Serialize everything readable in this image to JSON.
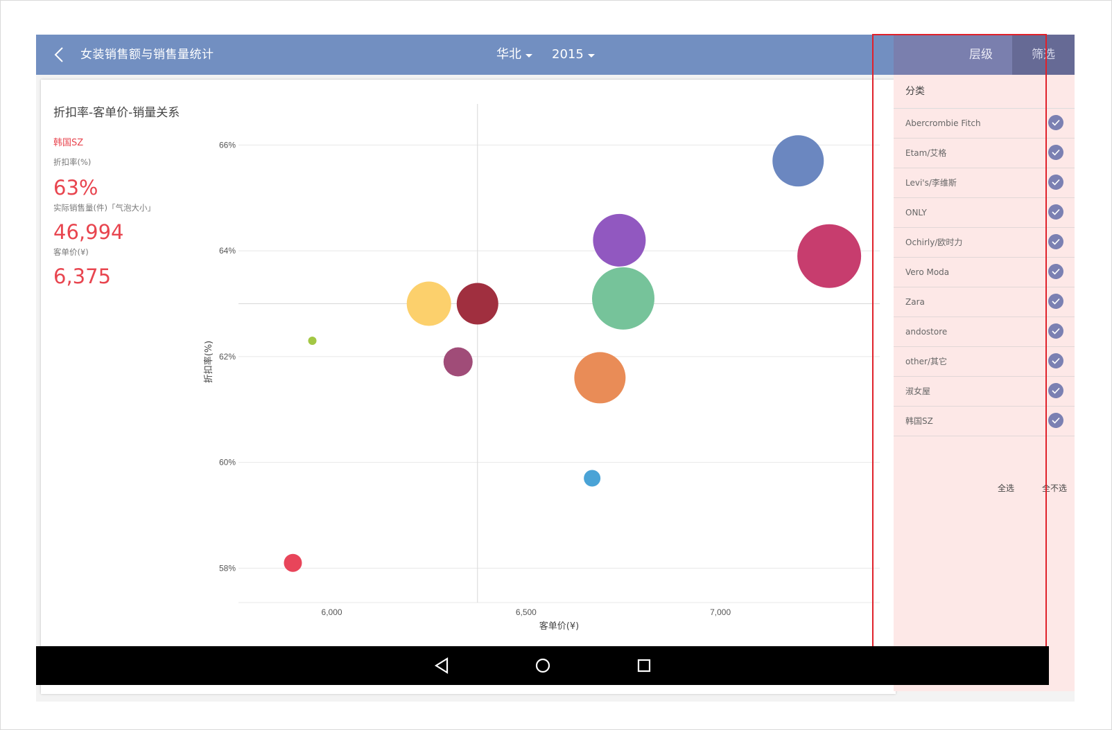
{
  "header": {
    "title": "女装销售额与销售量统计",
    "region": "华北",
    "year": "2015"
  },
  "panel_tabs": [
    {
      "label": "层级",
      "active": false
    },
    {
      "label": "筛选",
      "active": true
    }
  ],
  "info": {
    "selected": "韩国SZ",
    "discount_label": "折扣率(%)",
    "discount_value": "63%",
    "sales_label": "实际销售量(件)「气泡大小」",
    "sales_value": "46,994",
    "price_label": "客单价(¥)",
    "price_value": "6,375"
  },
  "filter": {
    "heading": "分类",
    "items": [
      "Abercrombie Fitch",
      "Etam/艾格",
      "Levi's/李维斯",
      "ONLY",
      "Ochirly/欧时力",
      "Vero Moda",
      "Zara",
      "andostore",
      "other/其它",
      "淑女屋",
      "韩国SZ"
    ],
    "select_all": "全选",
    "select_none": "全不选",
    "checked_color": "#7b80b2"
  },
  "chart_data": {
    "type": "scatter",
    "title": "折扣率-客单价-销量关系",
    "xlabel": "客单价(¥)",
    "ylabel": "折扣率(%)",
    "xlim": [
      5760,
      7410
    ],
    "ylim": [
      57.35,
      66.45
    ],
    "xticks": [
      6000,
      6500,
      7000
    ],
    "xtick_labels": [
      "6,000",
      "6,500",
      "7,000"
    ],
    "yticks": [
      58,
      60,
      62,
      64,
      66
    ],
    "ytick_labels": [
      "58%",
      "60%",
      "62%",
      "64%",
      "66%"
    ],
    "crosshair": {
      "x": 6375,
      "y": 63.0
    },
    "points": [
      {
        "x": 7200,
        "y": 65.7,
        "r": 37,
        "color": "#6b87c0"
      },
      {
        "x": 7280,
        "y": 63.9,
        "r": 46,
        "color": "#c73d6e"
      },
      {
        "x": 6740,
        "y": 64.2,
        "r": 38,
        "color": "#9158c0"
      },
      {
        "x": 6750,
        "y": 63.1,
        "r": 45,
        "color": "#76c39a"
      },
      {
        "x": 6250,
        "y": 63.0,
        "r": 32,
        "color": "#fcd06c"
      },
      {
        "x": 6375,
        "y": 63.0,
        "r": 30,
        "color": "#a02f3f"
      },
      {
        "x": 6325,
        "y": 61.9,
        "r": 21,
        "color": "#a04c78"
      },
      {
        "x": 6690,
        "y": 61.6,
        "r": 37,
        "color": "#e98c57"
      },
      {
        "x": 5950,
        "y": 62.3,
        "r": 6,
        "color": "#a3c744"
      },
      {
        "x": 6670,
        "y": 59.7,
        "r": 12,
        "color": "#4aa3d6"
      },
      {
        "x": 5900,
        "y": 58.1,
        "r": 13,
        "color": "#e8455a"
      }
    ],
    "grid": true
  }
}
